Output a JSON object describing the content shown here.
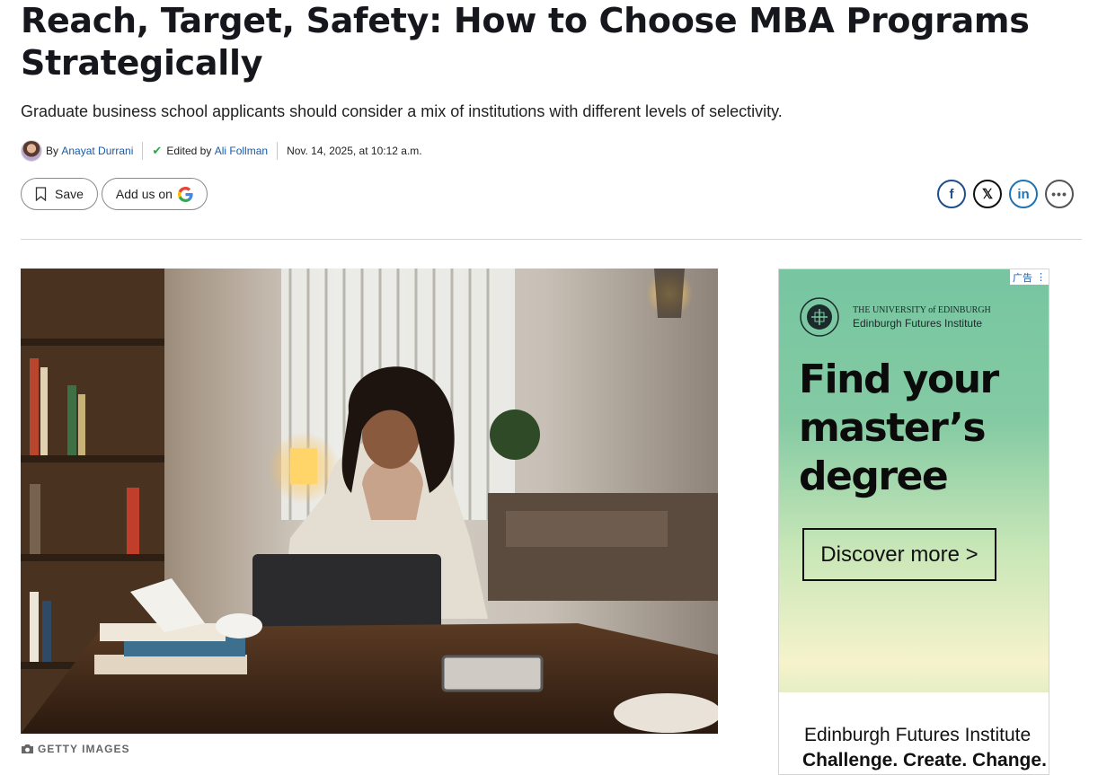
{
  "article": {
    "title": "Reach, Target, Safety: How to Choose MBA Programs Strategically",
    "dek": "Graduate business school applicants should consider a mix of institutions with different levels of selectivity.",
    "byline": {
      "by_prefix": "By",
      "author": "Anayat Durrani",
      "edited_prefix": "Edited by",
      "editor": "Ali Follman",
      "timestamp": "Nov. 14, 2025, at 10:12 a.m."
    },
    "actions": {
      "save_label": "Save",
      "add_us_label": "Add us on"
    },
    "share": {
      "facebook": "f",
      "x": "𝕏",
      "linkedin": "in",
      "more": "•••"
    },
    "image_credit": "GETTY IMAGES"
  },
  "ad": {
    "ad_label": "广告",
    "university_line1": "THE UNIVERSITY of EDINBURGH",
    "university_line2": "Edinburgh Futures Institute",
    "headline": "Find your master’s degree",
    "cta": "Discover more >",
    "footer_line1": "Edinburgh Futures Institute",
    "footer_line2": "Challenge. Create. Change."
  },
  "icons": {
    "bookmark": "bookmark-icon",
    "google": "google-logo-icon",
    "camera": "camera-icon",
    "check": "check-icon"
  },
  "colors": {
    "link": "#1a5aa6",
    "check": "#2aa84a",
    "ad_green": "#76c6a1"
  }
}
